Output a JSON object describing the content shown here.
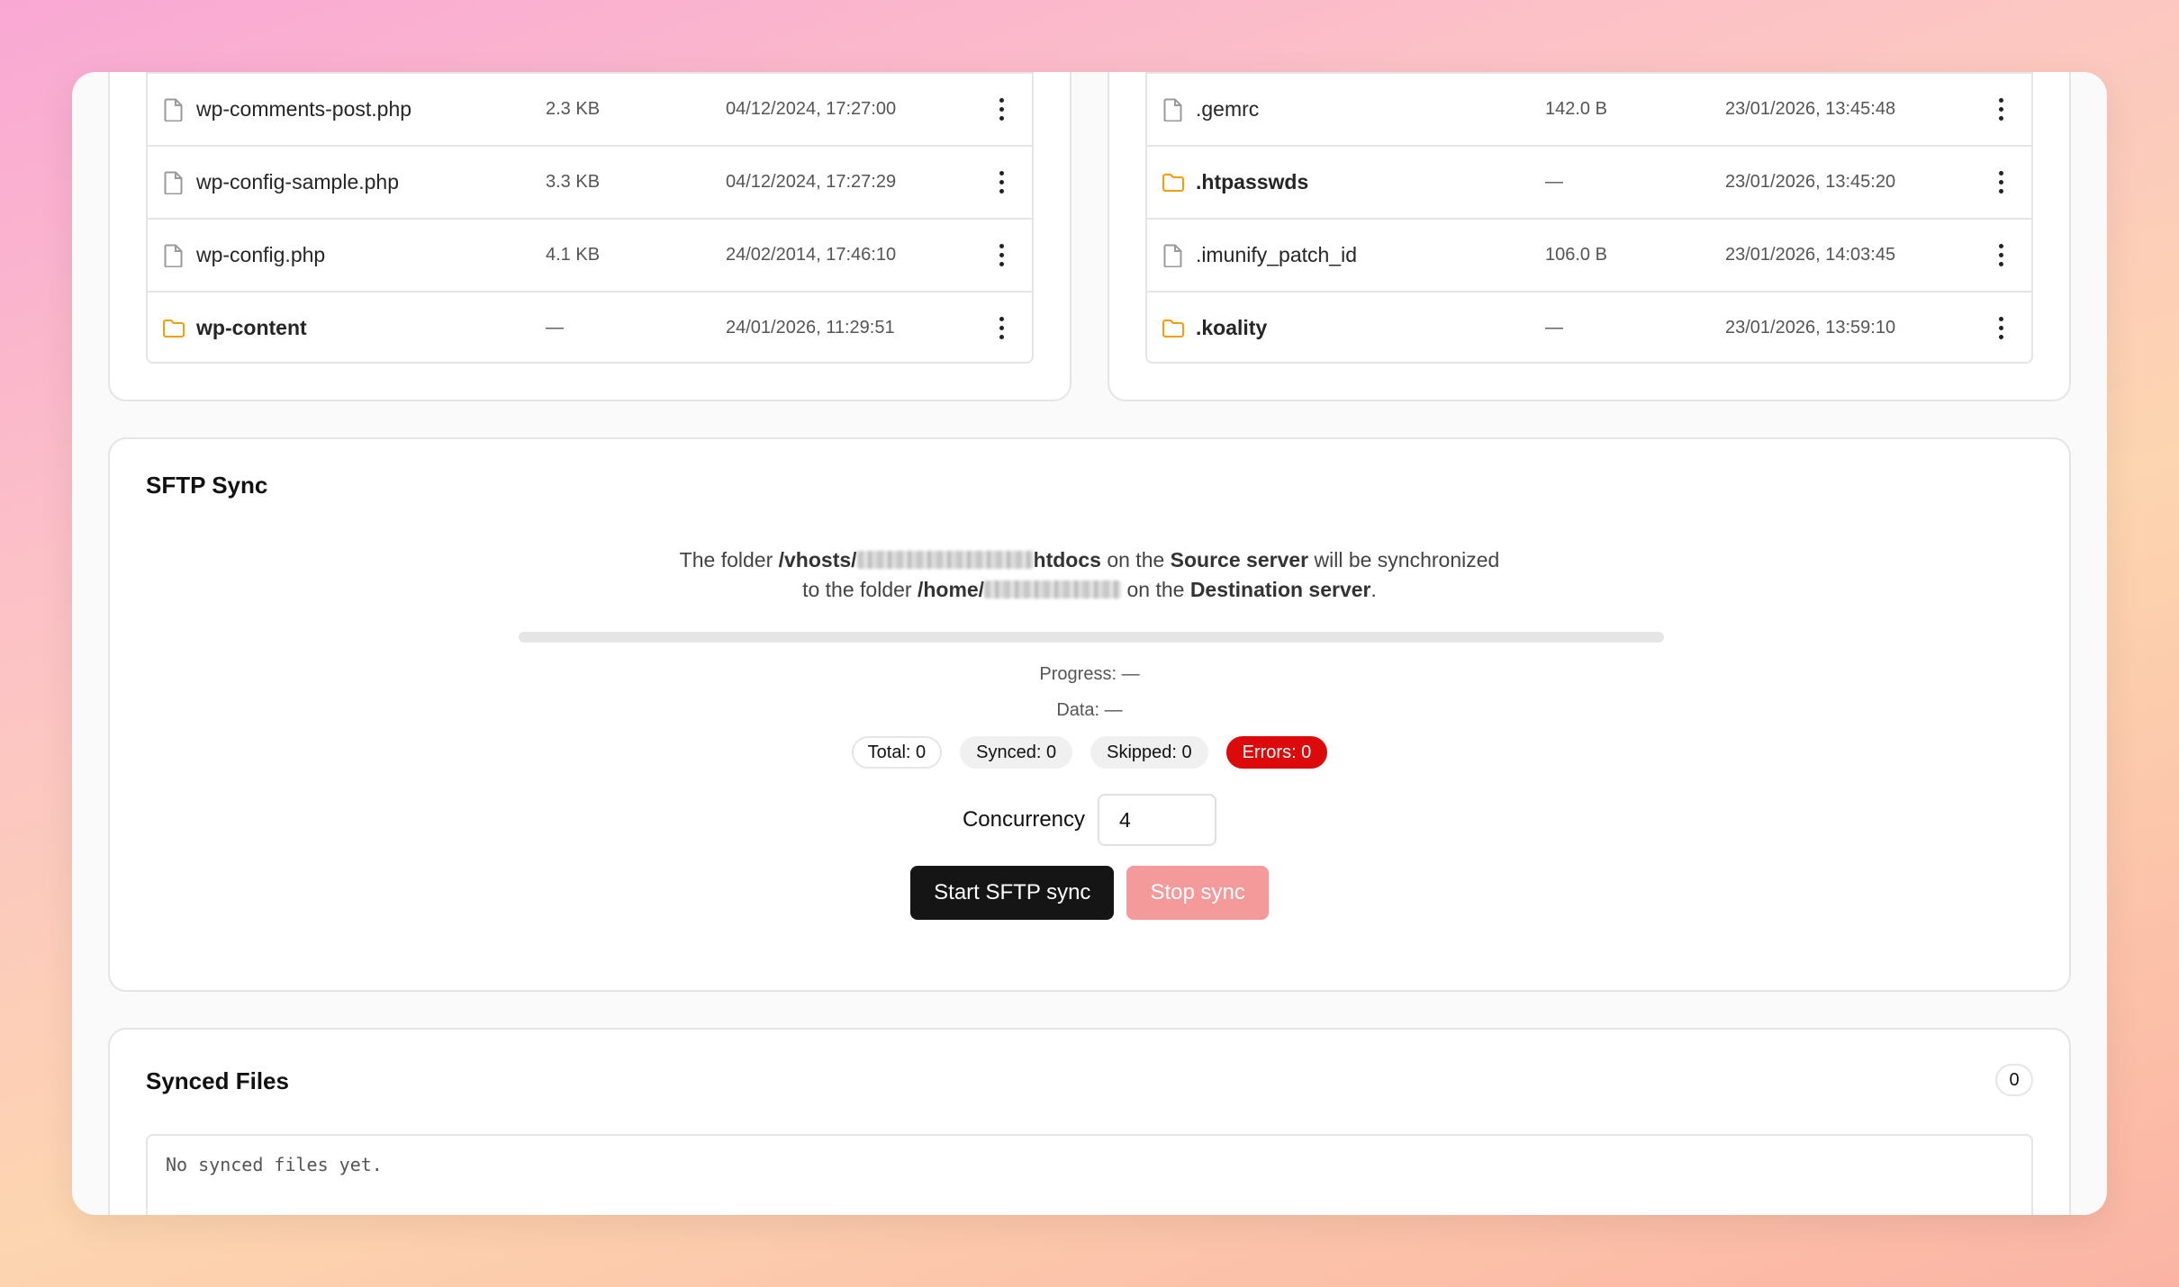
{
  "left_files": [
    {
      "name": "wp-comments-post.php",
      "size": "2.3 KB",
      "date": "04/12/2024, 17:27:00",
      "type": "file"
    },
    {
      "name": "wp-config-sample.php",
      "size": "3.3 KB",
      "date": "04/12/2024, 17:27:29",
      "type": "file"
    },
    {
      "name": "wp-config.php",
      "size": "4.1 KB",
      "date": "24/02/2014, 17:46:10",
      "type": "file"
    },
    {
      "name": "wp-content",
      "size": "—",
      "date": "24/01/2026, 11:29:51",
      "type": "folder"
    }
  ],
  "right_files": [
    {
      "name": ".gemrc",
      "size": "142.0 B",
      "date": "23/01/2026, 13:45:48",
      "type": "file"
    },
    {
      "name": ".htpasswds",
      "size": "—",
      "date": "23/01/2026, 13:45:20",
      "type": "folder"
    },
    {
      "name": ".imunify_patch_id",
      "size": "106.0 B",
      "date": "23/01/2026, 14:03:45",
      "type": "file"
    },
    {
      "name": ".koality",
      "size": "—",
      "date": "23/01/2026, 13:59:10",
      "type": "folder"
    }
  ],
  "sync": {
    "title": "SFTP Sync",
    "line1_prefix": "The folder ",
    "source_path_start": "/vhosts/",
    "source_path_end": "htdocs",
    "line1_mid": " on the ",
    "source_label": "Source server",
    "line1_suffix": " will be synchronized",
    "line2_prefix": "to the folder ",
    "dest_path_start": "/home/",
    "line2_mid": " on the ",
    "dest_label": "Destination server",
    "line2_suffix": ".",
    "progress_fraction": 0,
    "progress_text": "Progress: —",
    "data_text": "Data: —",
    "total": "Total: 0",
    "synced": "Synced: 0",
    "skipped": "Skipped: 0",
    "errors": "Errors: 0",
    "concurrency_label": "Concurrency",
    "concurrency_value": "4",
    "start_label": "Start SFTP sync",
    "stop_label": "Stop sync"
  },
  "synced_files": {
    "title": "Synced Files",
    "count": "0",
    "empty_text": "No synced files yet."
  },
  "colors": {
    "folder_icon": "#f59e0b",
    "file_icon": "#9a9a9a",
    "error_badge": "#dc0a0a",
    "primary_button": "#151515",
    "stop_button": "#f59a9a"
  }
}
